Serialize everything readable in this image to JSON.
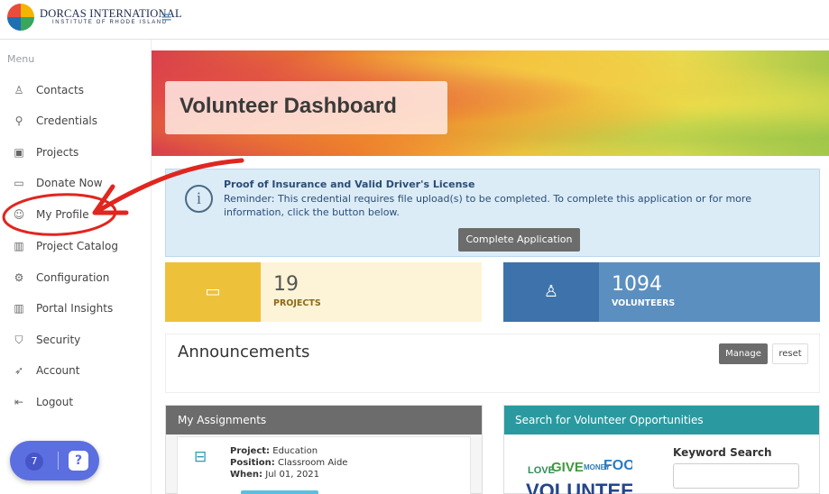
{
  "header": {
    "brand": "DORCAS INTERNATIONAL",
    "brand_sub": "INSTITUTE OF RHODE ISLAND",
    "menu_icon": "hamburger-icon",
    "logo_colors": [
      "#e84c3d",
      "#f4b400",
      "#1f6fb5",
      "#3aa55d"
    ]
  },
  "sidebar": {
    "menu_label": "Menu",
    "items": [
      {
        "label": "Contacts",
        "icon": "contacts-icon",
        "glyph": "♙"
      },
      {
        "label": "Credentials",
        "icon": "credentials-icon",
        "glyph": "⚲"
      },
      {
        "label": "Projects",
        "icon": "projects-icon",
        "glyph": "▣"
      },
      {
        "label": "Donate Now",
        "icon": "donate-icon",
        "glyph": "▭"
      },
      {
        "label": "My Profile",
        "icon": "smiley-icon",
        "glyph": "☺"
      },
      {
        "label": "Project Catalog",
        "icon": "catalog-icon",
        "glyph": "▥"
      },
      {
        "label": "Configuration",
        "icon": "gear-icon",
        "glyph": "⚙"
      },
      {
        "label": "Portal Insights",
        "icon": "chart-icon",
        "glyph": "▥"
      },
      {
        "label": "Security",
        "icon": "shield-icon",
        "glyph": "⛉"
      },
      {
        "label": "Account",
        "icon": "rocket-icon",
        "glyph": "➶"
      },
      {
        "label": "Logout",
        "icon": "logout-icon",
        "glyph": "⇤"
      }
    ],
    "chat_count": "7",
    "chat_glyph": "?"
  },
  "banner": {
    "title": "Volunteer Dashboard"
  },
  "alert": {
    "icon_glyph": "i",
    "title": "Proof of Insurance and Valid Driver's License",
    "text": "Reminder: This credential requires file upload(s) to be completed. To complete this application or for more information, click the button below.",
    "button": "Complete Application"
  },
  "stats": {
    "projects_count": "19",
    "projects_label": "PROJECTS",
    "projects_glyph": "▭",
    "volunteers_count": "1094",
    "volunteers_label": "VOLUNTEERS",
    "volunteers_glyph": "♙"
  },
  "announcements": {
    "title": "Announcements",
    "manage": "Manage",
    "reset": "reset"
  },
  "assignments": {
    "title": "My Assignments",
    "icon_glyph": "⊟",
    "project_label": "Project:",
    "project_value": "Education",
    "position_label": "Position:",
    "position_value": "Classroom Aide",
    "when_label": "When:",
    "when_value": "Jul 01, 2021"
  },
  "search_panel": {
    "title": "Search for Volunteer Opportunities",
    "keyword_label": "Keyword Search",
    "cloud_words": {
      "love": "LOVE",
      "give": "GIVE",
      "money": "MONEY",
      "food": "FOOD",
      "volunteer": "VOLUNTEER"
    }
  },
  "colors": {
    "accent_blue": "#3d73aa",
    "accent_yellow": "#eec13a",
    "teal": "#2a9aa0",
    "annotation_red": "#e0261f"
  }
}
